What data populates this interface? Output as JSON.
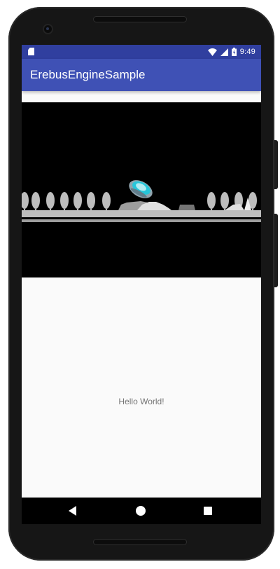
{
  "status_bar": {
    "time": "9:49",
    "left_icon": "sd-card-icon",
    "icons": [
      "wifi-icon",
      "signal-icon",
      "battery-icon"
    ]
  },
  "app_bar": {
    "title": "ErebusEngineSample"
  },
  "game_view": {
    "scene": "night landscape with trees, ground strip and a flying saucer",
    "sprite": "ufo-sprite"
  },
  "content": {
    "message": "Hello World!"
  },
  "nav_bar": {
    "buttons": [
      "back-icon",
      "home-icon",
      "recents-icon"
    ]
  },
  "colors": {
    "status_bar": "#303f9f",
    "app_bar": "#3f51b5",
    "game_background": "#000000",
    "scenery_gray": "#bdbdbd",
    "ufo_cyan": "#26c6da"
  }
}
